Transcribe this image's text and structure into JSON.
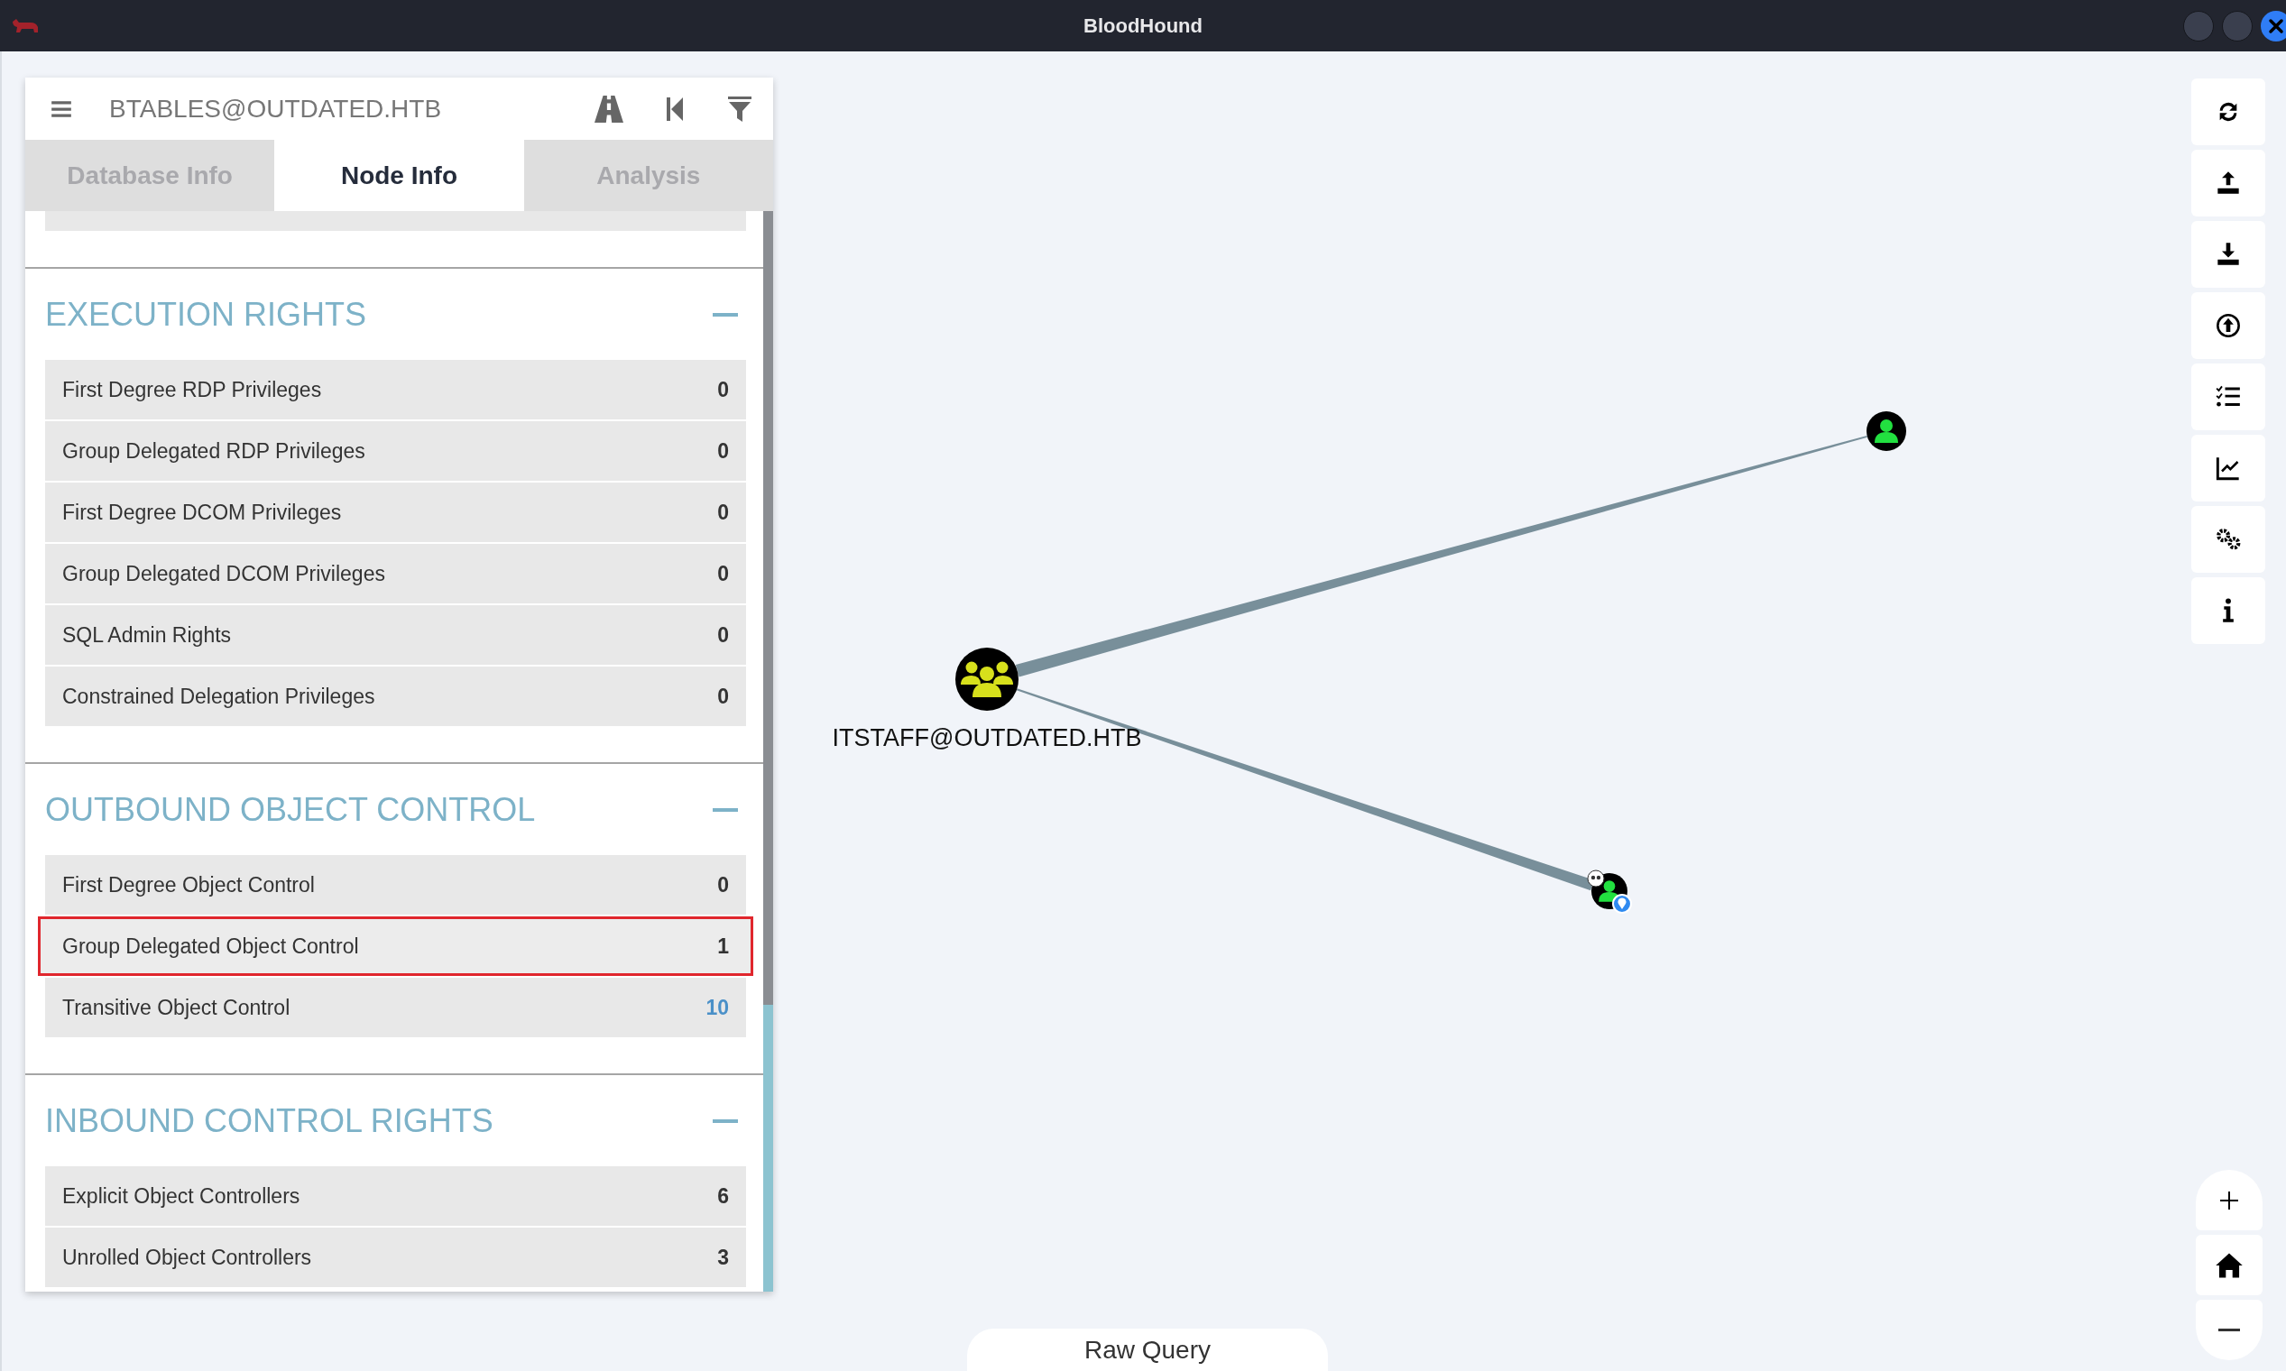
{
  "window": {
    "title": "BloodHound"
  },
  "panel": {
    "node_name": "BTABLES@OUTDATED.HTB",
    "tabs": [
      {
        "label": "Database Info",
        "selected": false
      },
      {
        "label": "Node Info",
        "selected": true
      },
      {
        "label": "Analysis",
        "selected": false
      }
    ],
    "sections": [
      {
        "title": "EXECUTION RIGHTS",
        "expanded": true,
        "rows": [
          {
            "label": "First Degree RDP Privileges",
            "value": "0",
            "highlighted": false,
            "link": false
          },
          {
            "label": "Group Delegated RDP Privileges",
            "value": "0",
            "highlighted": false,
            "link": false
          },
          {
            "label": "First Degree DCOM Privileges",
            "value": "0",
            "highlighted": false,
            "link": false
          },
          {
            "label": "Group Delegated DCOM Privileges",
            "value": "0",
            "highlighted": false,
            "link": false
          },
          {
            "label": "SQL Admin Rights",
            "value": "0",
            "highlighted": false,
            "link": false
          },
          {
            "label": "Constrained Delegation Privileges",
            "value": "0",
            "highlighted": false,
            "link": false
          }
        ]
      },
      {
        "title": "OUTBOUND OBJECT CONTROL",
        "expanded": true,
        "rows": [
          {
            "label": "First Degree Object Control",
            "value": "0",
            "highlighted": false,
            "link": false
          },
          {
            "label": "Group Delegated Object Control",
            "value": "1",
            "highlighted": true,
            "link": false
          },
          {
            "label": "Transitive Object Control",
            "value": "10",
            "highlighted": false,
            "link": true
          }
        ]
      },
      {
        "title": "INBOUND CONTROL RIGHTS",
        "expanded": true,
        "rows": [
          {
            "label": "Explicit Object Controllers",
            "value": "6",
            "highlighted": false,
            "link": false
          },
          {
            "label": "Unrolled Object Controllers",
            "value": "3",
            "highlighted": false,
            "link": false
          }
        ]
      }
    ]
  },
  "graph": {
    "nodes": [
      {
        "kind": "group",
        "label": "ITSTAFF@OUTDATED.HTB",
        "owned": false,
        "start": false
      },
      {
        "kind": "user",
        "owned": false,
        "start": false
      },
      {
        "kind": "user",
        "owned": true,
        "start": true
      }
    ]
  },
  "raw_query": {
    "label": "Raw Query"
  }
}
